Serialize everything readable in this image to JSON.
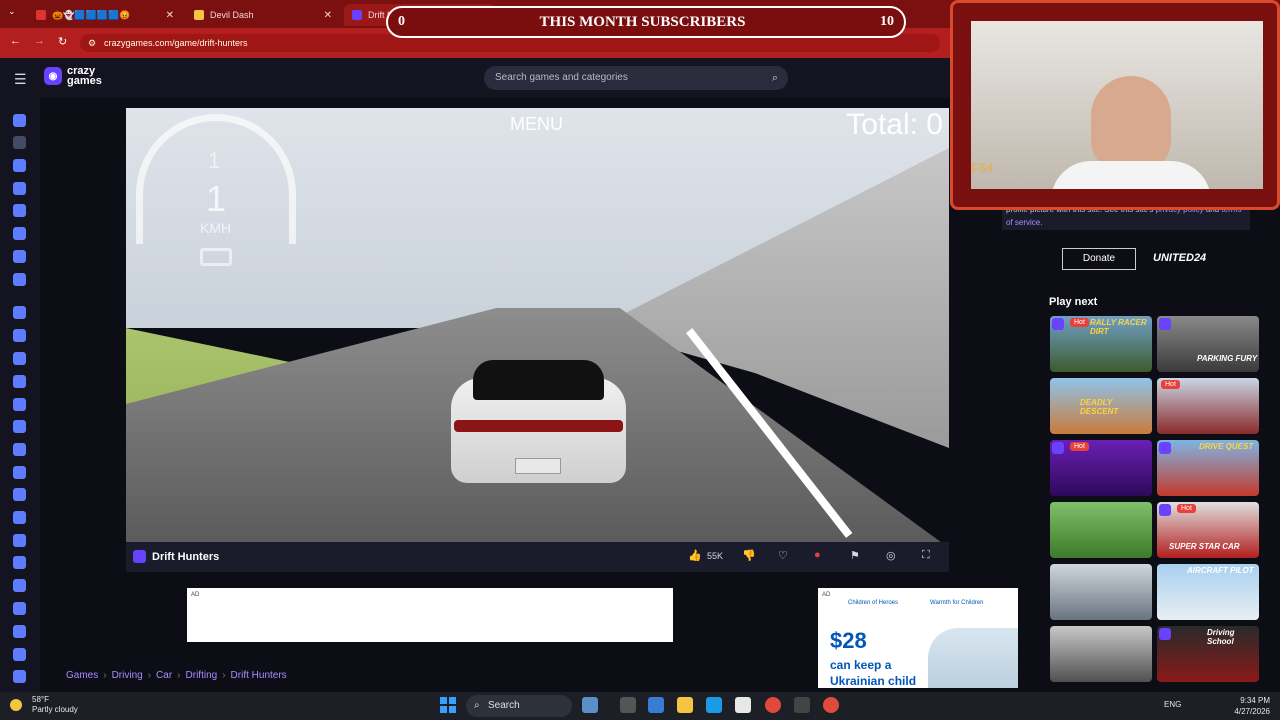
{
  "browser": {
    "tabs": [
      {
        "label": "🎃👻🟦🟦🟦🟦😡"
      },
      {
        "label": "Devil Dash"
      },
      {
        "label": "Drift Hunters - Play on Crazy"
      }
    ],
    "new_tab": "+",
    "url": "crazygames.com/game/drift-hunters"
  },
  "overlay": {
    "left_count": "0",
    "title": "THIS MONTH SUBSCRIBERS",
    "right_count": "10"
  },
  "site": {
    "logo_line1": "crazy",
    "logo_line2": "games",
    "search_placeholder": "Search games and categories"
  },
  "game": {
    "menu": "MENU",
    "total": "Total: 0",
    "speed_top": "1",
    "speed_main": "1",
    "speed_unit": "KMH",
    "title": "Drift Hunters",
    "likes": "55K"
  },
  "ads": {
    "ad_tag": "AD",
    "donation_org1": "Children of Heroes",
    "donation_org2": "Warmth for Children",
    "price": "$28",
    "line1": "can keep a",
    "line2": "Ukrainian child"
  },
  "breadcrumb": [
    "Games",
    "Driving",
    "Car",
    "Drifting",
    "Drift Hunters"
  ],
  "right_panel": {
    "consent_text": "To continue, google.com will share your name, email address, and profile picture with this site. See this site's",
    "privacy": "privacy policy",
    "and": "and",
    "terms": "terms of service.",
    "donate": "Donate",
    "united": "UNITED24",
    "play_next": "Play next",
    "hot": "Hot",
    "thumbs": [
      {
        "text": "RALLY RACER DIRT",
        "hot": true
      },
      {
        "text": "PARKING FURY",
        "hot": false
      },
      {
        "text": "DEADLY DESCENT",
        "hot": false
      },
      {
        "text": "",
        "hot": true
      },
      {
        "text": "",
        "hot": true
      },
      {
        "text": "DRIVE QUEST",
        "hot": false
      },
      {
        "text": "",
        "hot": false
      },
      {
        "text": "SUPER STAR CAR",
        "hot": true
      },
      {
        "text": "",
        "hot": false
      },
      {
        "text": "AIRCRAFT PILOT",
        "hot": false
      },
      {
        "text": "",
        "hot": false
      },
      {
        "text": "Driving School",
        "hot": false
      }
    ]
  },
  "webcam": {
    "tag": "FS4"
  },
  "taskbar": {
    "temp": "58°F",
    "weather": "Partly cloudy",
    "search": "Search",
    "lang": "ENG",
    "time": "9:34 PM",
    "date": "4/27/2026"
  }
}
